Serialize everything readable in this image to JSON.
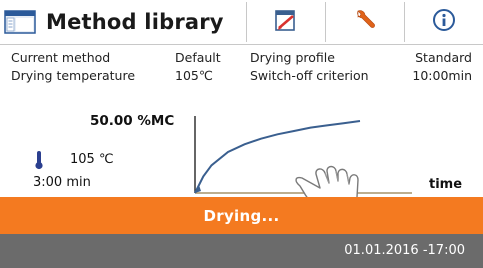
{
  "header": {
    "title": "Method library",
    "icons": [
      "method-library-icon",
      "edit-icon",
      "wrench-icon",
      "info-icon"
    ]
  },
  "info": {
    "current_method_label": "Current method",
    "current_method_value": "Default",
    "drying_profile_label": "Drying profile",
    "drying_profile_value": "Standard",
    "drying_temp_label": "Drying temperature",
    "drying_temp_value": "105℃",
    "switch_off_label": "Switch-off criterion",
    "switch_off_value": "10:00min"
  },
  "left_panel": {
    "moisture_value": "50.00 %MC",
    "temperature_value": "105 ℃",
    "elapsed_time": "3:00 min"
  },
  "chart_data": {
    "type": "line",
    "xlabel": "time",
    "series": [
      {
        "x": [
          0,
          0.5,
          1,
          2,
          3,
          4,
          5,
          6,
          7,
          8,
          9,
          10
        ],
        "values": [
          0,
          15,
          25,
          37,
          44,
          49,
          53,
          56,
          59,
          61,
          63,
          65
        ]
      }
    ]
  },
  "status": {
    "drying_label": "Drying...",
    "datetime": "01.01.2016 -17:00"
  },
  "colors": {
    "accent": "#f47a20",
    "status_bar": "#6b6b6b",
    "curve": "#3a5f8f"
  }
}
